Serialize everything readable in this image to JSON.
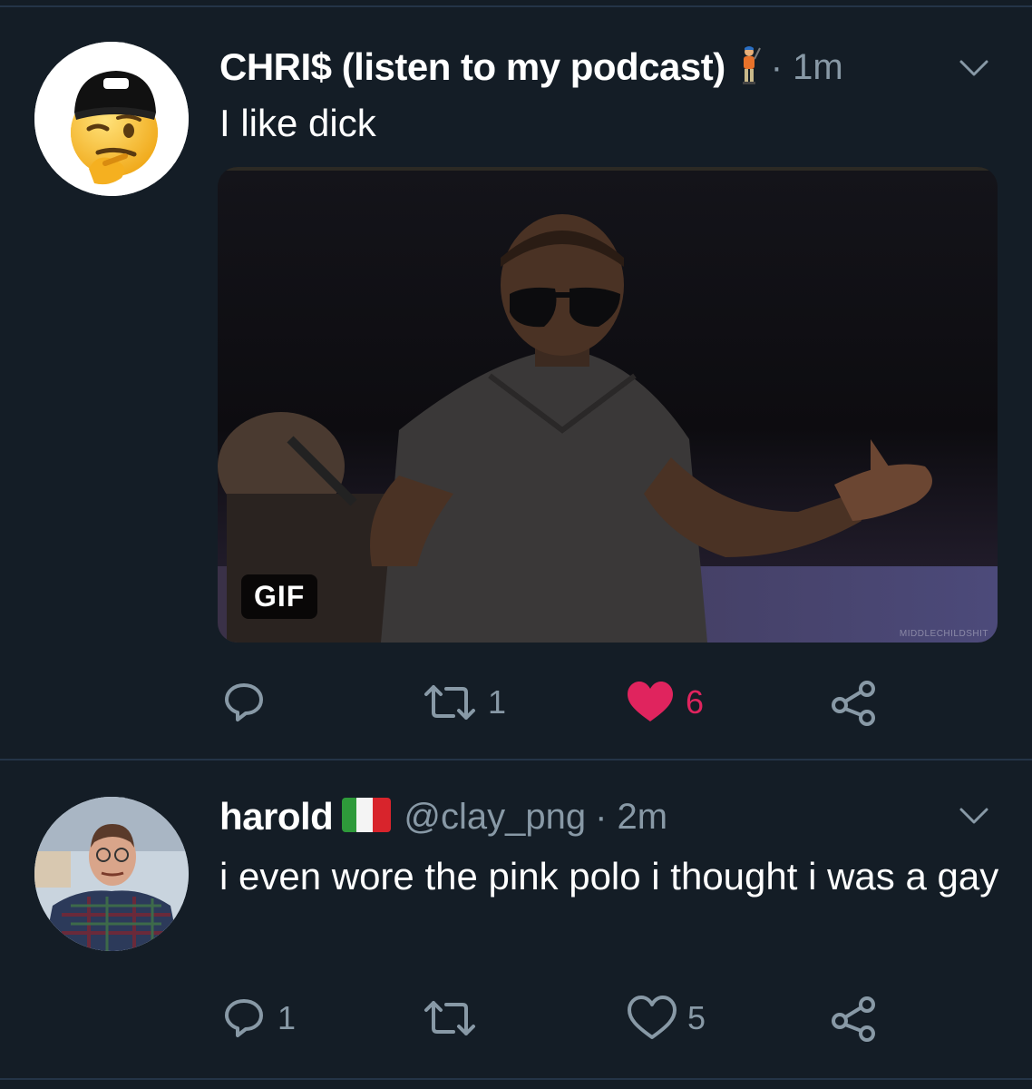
{
  "tweets": [
    {
      "display_name": "CHRI$ (listen to my podcast)",
      "name_emoji": "golfer-emoji",
      "handle": "",
      "time": "· 1m",
      "text": "I like dick",
      "avatar": "thinking-face-cap-emoji",
      "media": {
        "type": "gif",
        "badge": "GIF",
        "watermark": "MIDDLECHILDSHIT"
      },
      "actions": {
        "reply_count": "",
        "retweet_count": "1",
        "like_count": "6",
        "liked": true
      }
    },
    {
      "display_name": "harold",
      "name_emoji": "italy-flag",
      "handle": "@clay_png",
      "time": "· 2m",
      "text": "i even wore the pink polo i thought i was a gay",
      "avatar": "man-in-plaid-shirt-photo",
      "actions": {
        "reply_count": "1",
        "retweet_count": "",
        "like_count": "5",
        "liked": false
      }
    }
  ],
  "colors": {
    "background": "#141d26",
    "divider": "#243447",
    "muted": "#8899a6",
    "like": "#e0245e"
  }
}
